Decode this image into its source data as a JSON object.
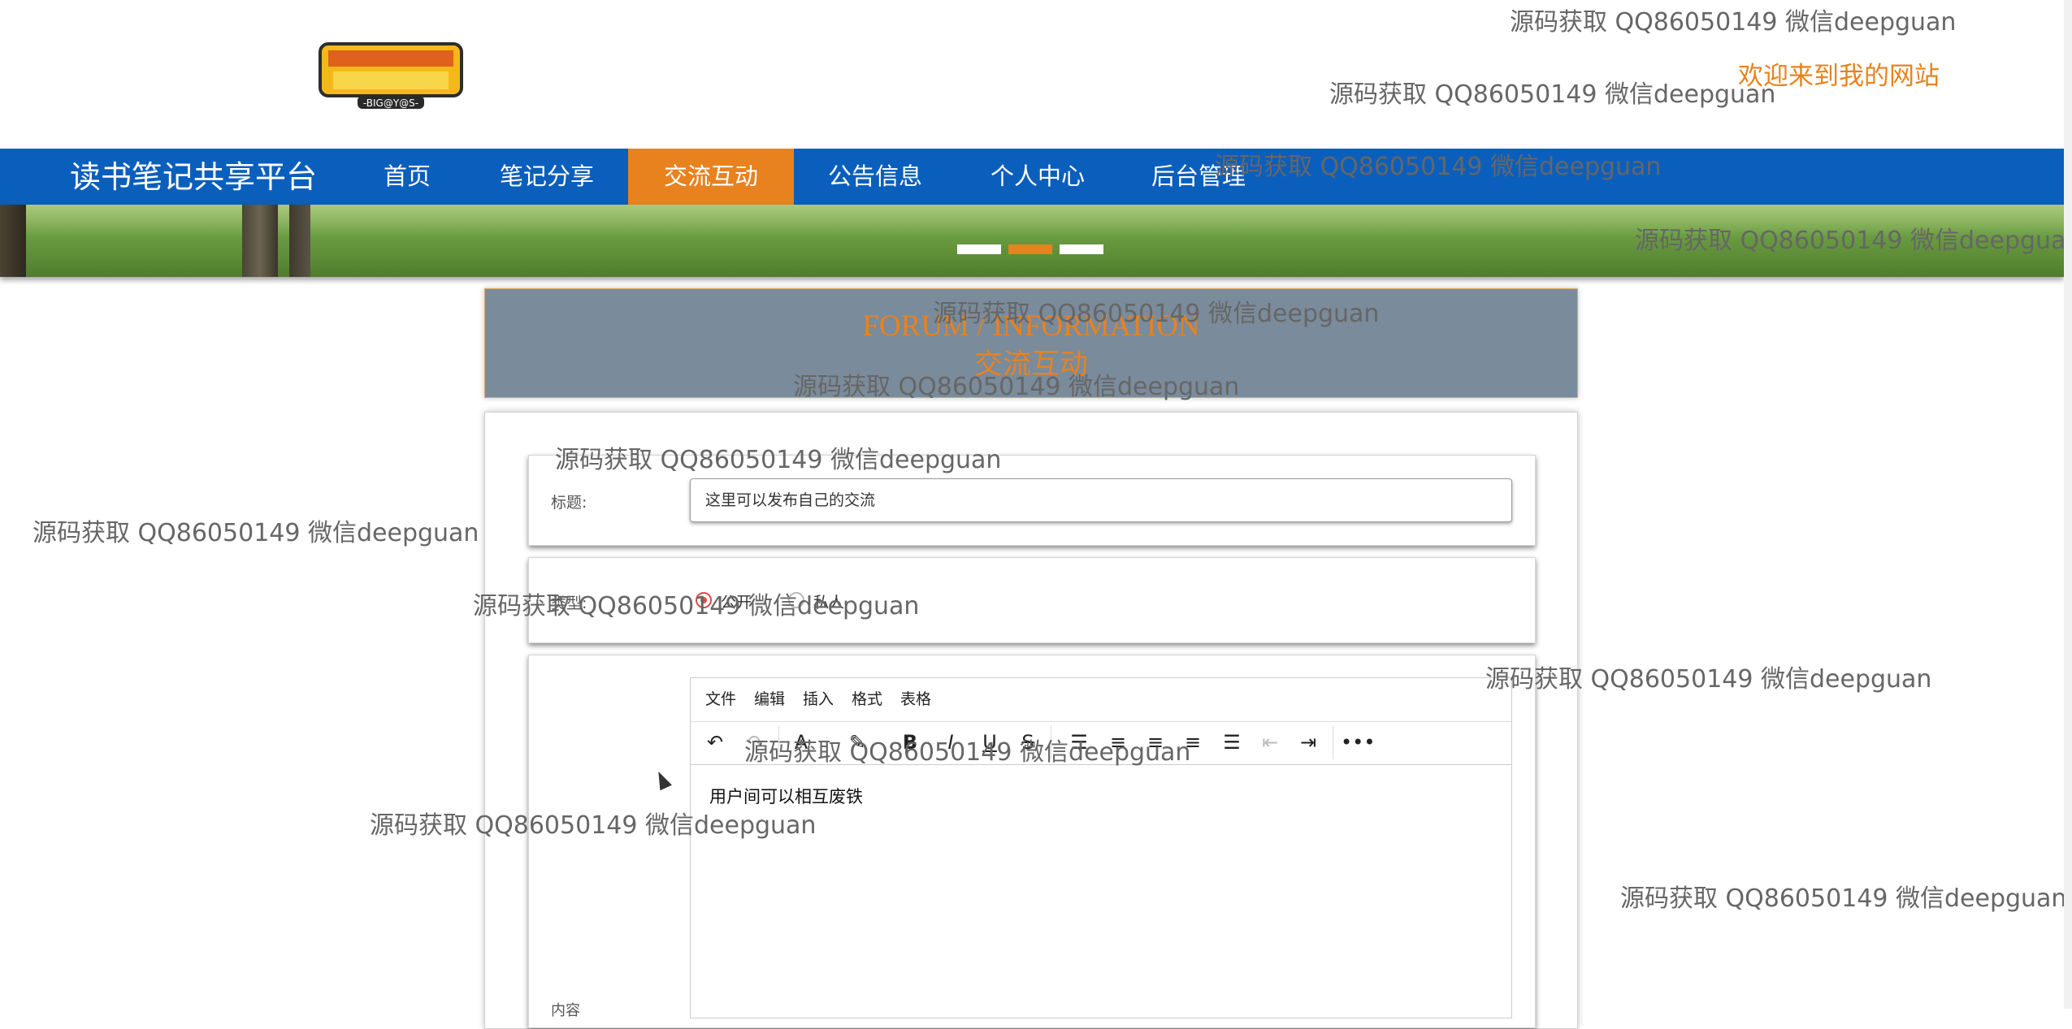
{
  "header": {
    "welcome": "欢迎来到我的网站"
  },
  "navbar": {
    "brand": "读书笔记共享平台",
    "items": [
      {
        "label": "首页"
      },
      {
        "label": "笔记分享"
      },
      {
        "label": "交流互动",
        "active": true
      },
      {
        "label": "公告信息"
      },
      {
        "label": "个人中心"
      },
      {
        "label": "后台管理"
      }
    ]
  },
  "banner": {
    "active_slide": 2,
    "slides": 3
  },
  "section": {
    "title_en": "FORUM / INFORMATION",
    "title_zh": "交流互动"
  },
  "form": {
    "title_label": "标题:",
    "title_value": "这里可以发布自己的交流",
    "type_label": "类型:",
    "radio_public": "公开",
    "radio_private": "私人",
    "content_label": "内容",
    "editor_menus": [
      "文件",
      "编辑",
      "插入",
      "格式",
      "表格"
    ],
    "editor_text": "用户间可以相互废铁"
  },
  "watermark": "源码获取 QQ86050149 微信deepguan",
  "colors": {
    "nav_bg": "#0b5fbc",
    "accent": "#e8821e",
    "section_bg": "#7a8b9b"
  }
}
